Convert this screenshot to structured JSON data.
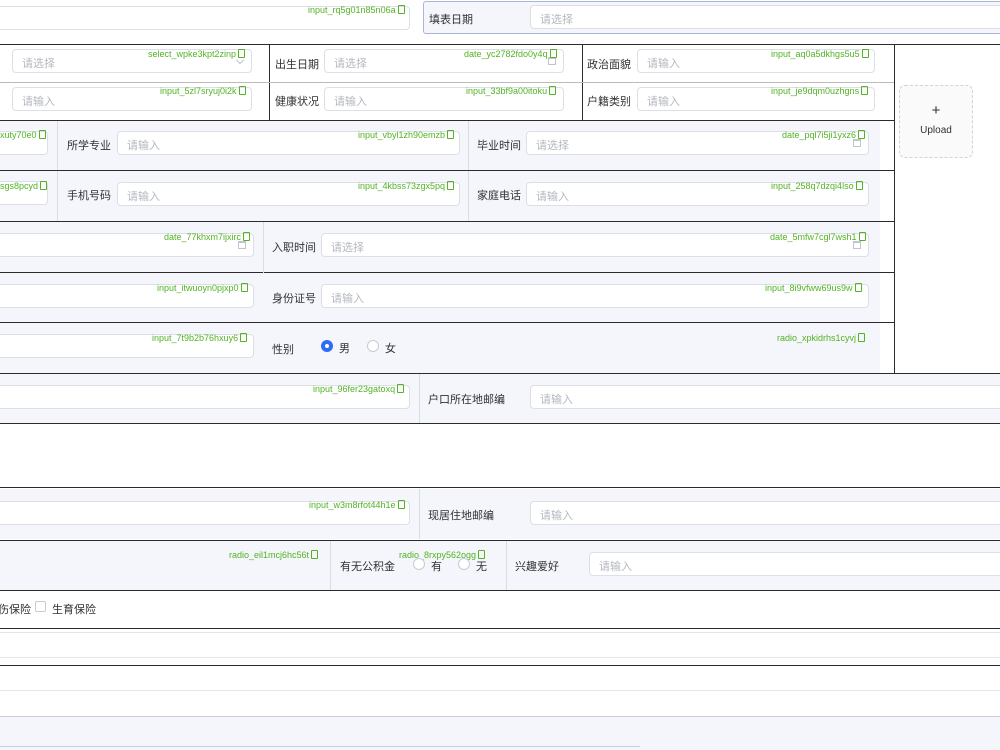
{
  "colors": {
    "accent": "#2f6cf4",
    "tag": "#52b324",
    "placeholder": "#b4b8bf",
    "band": "#f4f6fb"
  },
  "icons": [
    "copy-icon",
    "calendar-icon",
    "chevron-down-icon",
    "plus-icon"
  ],
  "top": {
    "tag_left": "input_rq5g01n85n06a",
    "fill_date_label": "填表日期",
    "fill_date_placeholder": "请选择"
  },
  "personal": {
    "row1": {
      "select_tag": "select_wpke3kpt2zinp",
      "select_placeholder": "请选择",
      "birth_label": "出生日期",
      "birth_tag": "date_yc2782fdo0y4q",
      "birth_placeholder": "请选择",
      "political_label": "政治面貌",
      "political_tag": "input_aq0a5dkhgs5u5",
      "political_placeholder": "请输入"
    },
    "row2": {
      "input_tag": "input_5zl7sryuj0i2k",
      "input_placeholder": "请输入",
      "health_label": "健康状况",
      "health_tag": "input_33bf9a00itoku",
      "health_placeholder": "请输入",
      "household_label": "户籍类别",
      "household_tag": "input_je9dqm0uzhgns",
      "household_placeholder": "请输入"
    },
    "row3": {
      "left_tag": "xuty70e0",
      "major_label": "所学专业",
      "major_tag": "input_vbyl1zh90emzb",
      "major_placeholder": "请输入",
      "grad_label": "毕业时间",
      "grad_tag": "date_pql7i5ji1yxz6",
      "grad_placeholder": "请选择"
    },
    "row4": {
      "left_tag": "sgs8pcyd",
      "mobile_label": "手机号码",
      "mobile_tag": "input_4kbss73zgx5pq",
      "mobile_placeholder": "请输入",
      "home_label": "家庭电话",
      "home_tag": "input_258q7dzqi4lso",
      "home_placeholder": "请输入"
    },
    "row5": {
      "left_tag": "date_77khxm7ijxirc",
      "join_label": "入职时间",
      "join_tag": "date_5mfw7cgl7wsh1",
      "join_placeholder": "请选择"
    },
    "row6": {
      "left_tag": "input_itwuoyn0pjxp0",
      "id_label": "身份证号",
      "id_tag": "input_8i9vfww69us9w",
      "id_placeholder": "请输入"
    },
    "row7": {
      "left_tag": "input_7t9b2b76hxuy6",
      "gender_label": "性别",
      "gender_tag": "radio_xpkidrhs1cyvj",
      "male": "男",
      "female": "女",
      "selected": "男"
    },
    "upload_label": "Upload",
    "upload_plus": "+"
  },
  "address": {
    "tag": "input_96fer23gatoxq",
    "postcode_label": "户口所在地邮编",
    "postcode_placeholder": "请输入"
  },
  "current": {
    "tag": "input_w3m8rfot44h1e",
    "postcode_label": "现居住地邮编",
    "postcode_placeholder": "请输入"
  },
  "benefits": {
    "left_radio_tag": "radio_eil1mcj6hc56t",
    "fund_label": "有无公积金",
    "fund_tag": "radio_8rxpy562ogg",
    "yes": "有",
    "no": "无",
    "hobby_label": "兴趣爱好",
    "hobby_placeholder": "请输入"
  },
  "insurance": {
    "partial_label": "伤保险",
    "maternity_label": "生育保险"
  }
}
